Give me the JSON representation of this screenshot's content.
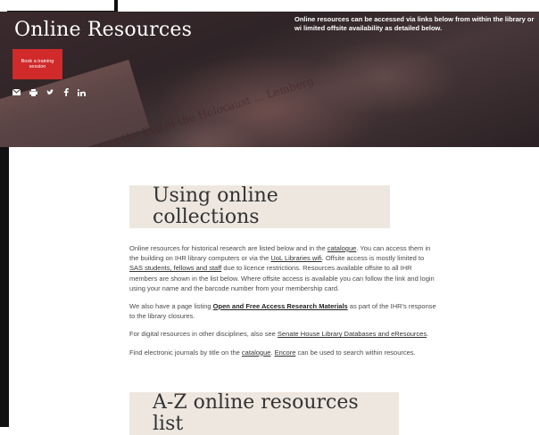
{
  "hero": {
    "title": "Online Resources",
    "note": "Online resources can be accessed via links below from within the library or wi limited offsite availability as detailed below.",
    "training_button": "Book a training session",
    "paper_text": "ewish Pogroms on the Eve of the Holocaust ... Lemberg",
    "share_icons": [
      "email-icon",
      "print-icon",
      "twitter-icon",
      "facebook-icon",
      "linkedin-icon"
    ]
  },
  "main": {
    "heading1": "Using online collections",
    "p1": {
      "t1": "Online resources for historical research are listed below and in the ",
      "link_catalogue": "catalogue",
      "t2": ". You can access them in the building on IHR library computers or via the ",
      "link_wifi": "UoL Libraries wifi",
      "t3": ". Offsite access is mostly limited to ",
      "link_sas": "SAS students, fellows and staff",
      "t4": " due to licence restrictions. Resources available offsite to all IHR members are shown in the list below. Where offsite access is available you can follow the link and login using your name and the barcode number from your membership card."
    },
    "p2": {
      "t1": "We also have a page listing ",
      "link_open": "Open and Free Access Research Materials",
      "t2": " as part of the IHR's response to the library closures."
    },
    "p3": {
      "t1": "For digital resources in other disciplines, also see ",
      "link_senate": "Senate House Library Databases and eResources",
      "t2": "."
    },
    "p4": {
      "t1": "Find electronic journals by title on the ",
      "link_catalogue": "catalogue",
      "t2": ". ",
      "link_encore": "Encore",
      "t3": " can be used to search within resources."
    },
    "heading2": "A-Z online resources list"
  },
  "colors": {
    "accent_red": "#d02a2a",
    "heading_bg": "#ede7df"
  }
}
